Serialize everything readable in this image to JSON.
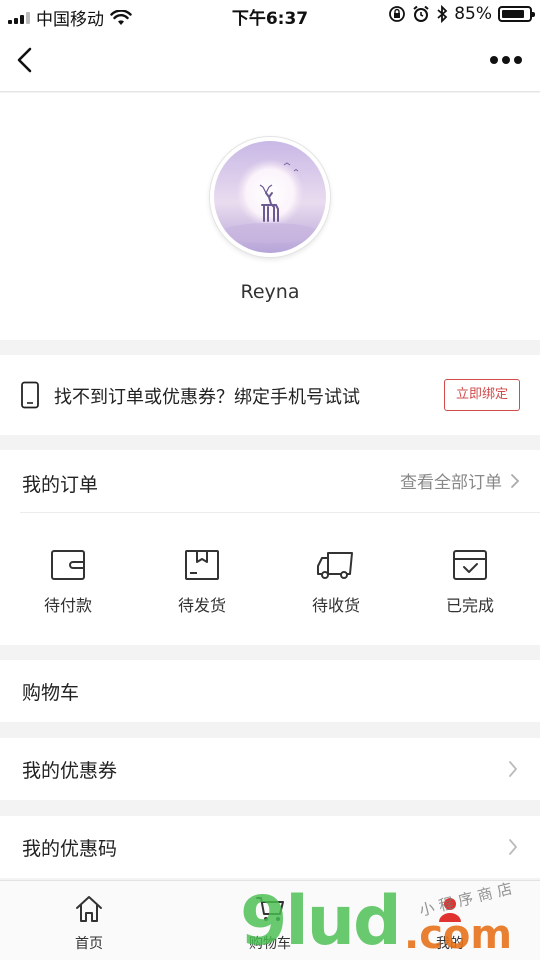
{
  "status_bar": {
    "carrier": "中国移动",
    "time": "下午6:37",
    "battery_text": "85%",
    "battery_level": 0.85
  },
  "nav": {
    "back_icon": "chevron-left-icon",
    "more_icon": "more-dots-icon"
  },
  "profile": {
    "username": "Reyna"
  },
  "bind_banner": {
    "text": "找不到订单或优惠券？绑定手机号试试",
    "button_label": "立即绑定",
    "accent_color": "#d14b4b"
  },
  "orders": {
    "title": "我的订单",
    "view_all": "查看全部订单",
    "items": [
      {
        "label": "待付款",
        "icon": "wallet-icon"
      },
      {
        "label": "待发货",
        "icon": "box-icon"
      },
      {
        "label": "待收货",
        "icon": "truck-icon"
      },
      {
        "label": "已完成",
        "icon": "check-calendar-icon"
      }
    ]
  },
  "rows": {
    "cart": "购物车",
    "coupons": "我的优惠券",
    "promo_codes": "我的优惠码"
  },
  "tabs": [
    {
      "label": "首页",
      "icon": "home-icon"
    },
    {
      "label": "购物车",
      "icon": "cart-icon"
    },
    {
      "label": "我的",
      "icon": "user-icon"
    }
  ],
  "watermark": {
    "main": "9lud",
    "suffix": ".com",
    "sub": "小程序商店"
  }
}
